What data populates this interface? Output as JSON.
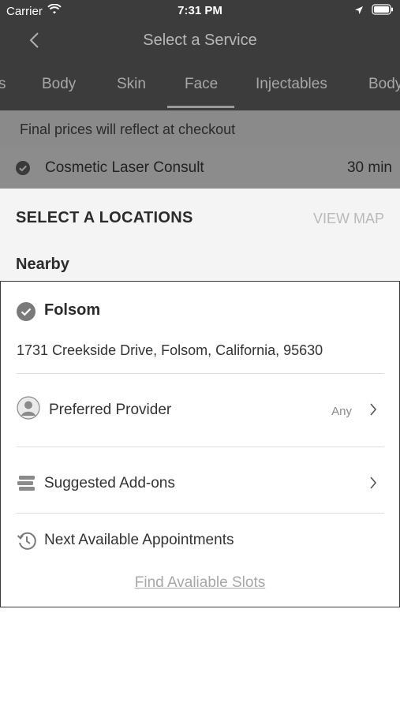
{
  "status_bar": {
    "carrier": "Carrier",
    "time": "7:31 PM"
  },
  "nav": {
    "title": "Select a Service"
  },
  "tabs": [
    {
      "label": "s"
    },
    {
      "label": "Body"
    },
    {
      "label": "Skin"
    },
    {
      "label": "Face"
    },
    {
      "label": "Injectables"
    },
    {
      "label": "Body"
    }
  ],
  "selected_tab": "Face",
  "notice": {
    "text": "Final prices will reflect at checkout"
  },
  "service": {
    "name": "Cosmetic Laser Consult",
    "duration": "30 min"
  },
  "locations": {
    "heading": "SELECT A LOCATIONS",
    "view_map": "VIEW MAP",
    "nearby_heading": "Nearby"
  },
  "location_card": {
    "name": "Folsom",
    "address": "1731 Creekside Drive, Folsom, California, 95630",
    "preferred_provider": {
      "label": "Preferred Provider",
      "value": "Any"
    },
    "suggested_addons": {
      "label": "Suggested Add-ons"
    },
    "next_available": {
      "label": "Next Available Appointments"
    },
    "find_slots": "Find Avaliable Slots"
  },
  "icons": {
    "wifi": "wifi-icon",
    "location_arrow": "location-arrow-icon",
    "battery": "battery-icon",
    "back": "chevron-left-icon",
    "check": "check-circle-icon",
    "person": "person-icon",
    "stack": "layers-icon",
    "history": "history-icon",
    "chevron": "chevron-right-icon"
  }
}
